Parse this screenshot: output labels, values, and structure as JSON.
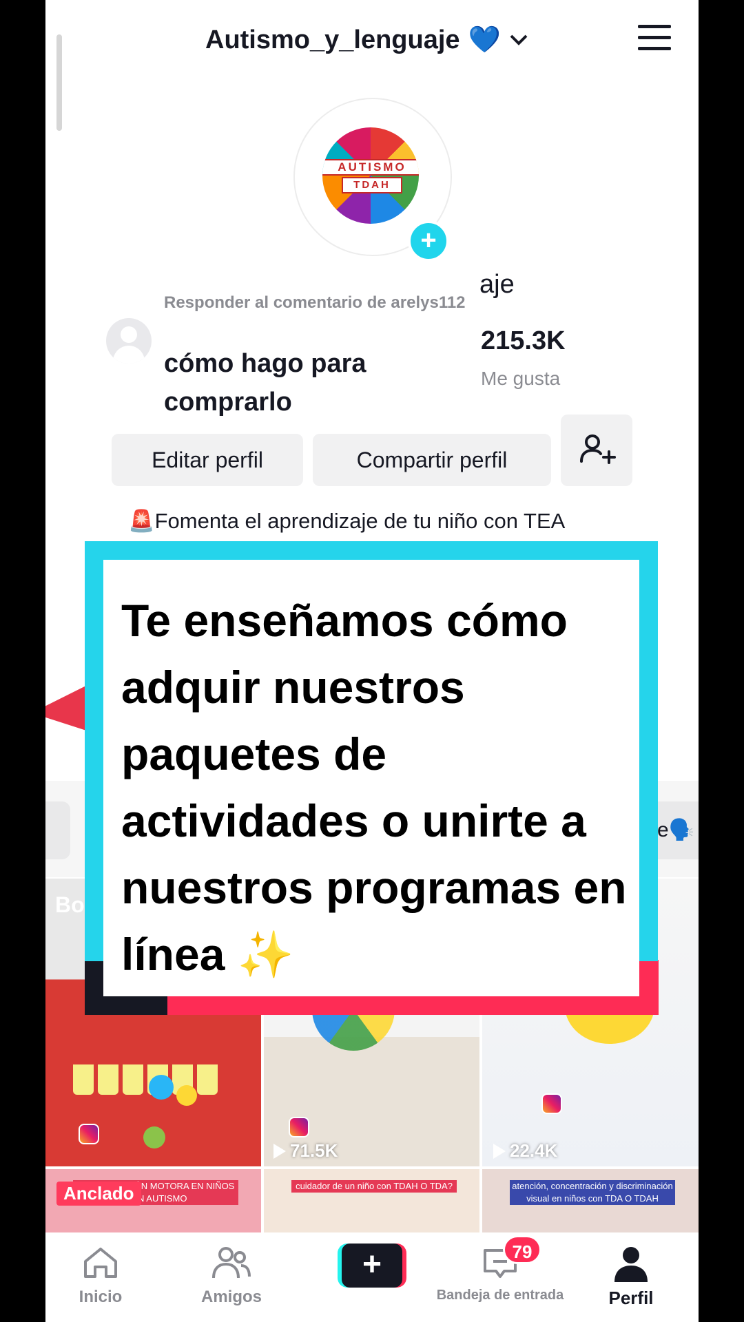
{
  "header": {
    "account_name": "Autismo_y_lenguaje",
    "heart": "💙",
    "chevron": "⌄"
  },
  "avatar": {
    "line1": "AUTISMO",
    "line2": "TDAH",
    "add_symbol": "+"
  },
  "profile": {
    "name_fragment": "aje",
    "likes_count": "215.3K",
    "likes_label": "Me gusta"
  },
  "reply_comment": {
    "meta": "Responder al comentario de arelys112",
    "text": "cómo hago para comprarlo"
  },
  "buttons": {
    "edit": "Editar perfil",
    "share": "Compartir perfil"
  },
  "bio": {
    "siren": "🚨",
    "text": "Fomenta el aprendizaje de tu niño con TEA"
  },
  "highlights": {
    "right_chip": "e🗣️"
  },
  "videos": [
    {
      "label": "Bo",
      "badge": "Anclado",
      "views": ""
    },
    {
      "views": "71.5K"
    },
    {
      "views": "22.4K"
    }
  ],
  "thumbnail_captions": {
    "t4": "COORDINACIÓN MOTORA EN NIÑOS CON AUTISMO",
    "t5": "cuidador de un niño con TDAH O TDA?",
    "t6": "atención, concentración y discriminación visual en niños con TDA O TDAH"
  },
  "overlay": {
    "text": "Te enseñamos cómo adquir nuestros paquetes de actividades o unirte a nuestros programas en línea ✨"
  },
  "nav": {
    "home": "Inicio",
    "friends": "Amigos",
    "create": "+",
    "inbox": "Bandeja de entrada",
    "inbox_badge": "79",
    "profile": "Perfil"
  },
  "colors": {
    "cyan": "#25d4eb",
    "red": "#fe2c55",
    "dark": "#161823",
    "muted": "#8a8b91"
  },
  "icons": [
    "chevron-down-icon",
    "menu-icon",
    "add-icon",
    "add-friend-icon",
    "home-icon",
    "friends-icon",
    "plus-icon",
    "inbox-icon",
    "profile-icon",
    "instagram-icon",
    "play-icon",
    "sparkles-icon"
  ]
}
